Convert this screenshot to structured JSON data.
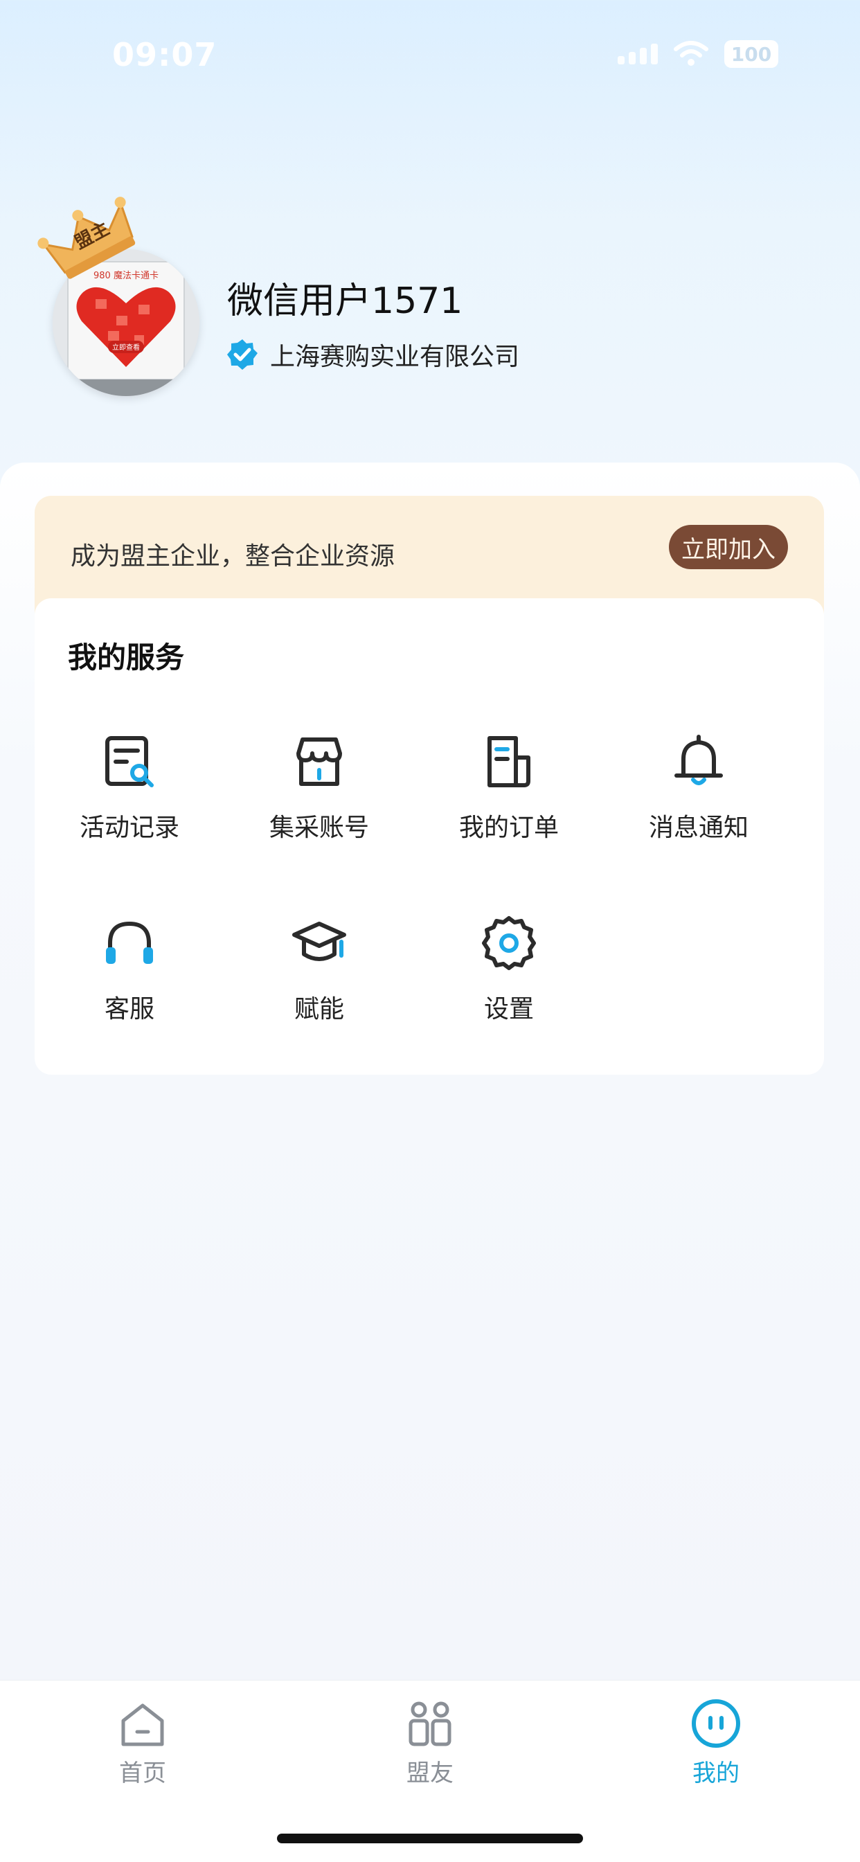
{
  "status_bar": {
    "time": "09:07",
    "battery": "100"
  },
  "profile": {
    "crown_label": "盟主",
    "avatar_card_title": "980 魔法卡通卡",
    "avatar_card_button": "立即查看",
    "name": "微信用户1571",
    "company": "上海赛购实业有限公司",
    "verified_icon": "verified-badge-icon"
  },
  "join_banner": {
    "text": "成为盟主企业，整合企业资源",
    "button_label": "立即加入"
  },
  "services": {
    "title": "我的服务",
    "items": [
      {
        "label": "活动记录",
        "icon": "activity-record-icon"
      },
      {
        "label": "集采账号",
        "icon": "store-icon"
      },
      {
        "label": "我的订单",
        "icon": "order-icon"
      },
      {
        "label": "消息通知",
        "icon": "bell-icon"
      },
      {
        "label": "客服",
        "icon": "headset-icon"
      },
      {
        "label": "赋能",
        "icon": "graduation-cap-icon"
      },
      {
        "label": "设置",
        "icon": "gear-icon"
      }
    ]
  },
  "tabbar": {
    "tabs": [
      {
        "label": "首页",
        "icon": "home-icon",
        "active": false
      },
      {
        "label": "盟友",
        "icon": "allies-icon",
        "active": false
      },
      {
        "label": "我的",
        "icon": "profile-face-icon",
        "active": true
      }
    ]
  },
  "colors": {
    "accent": "#17a5d8",
    "join_button": "#7a4a35",
    "banner": "#fcf0dc"
  }
}
